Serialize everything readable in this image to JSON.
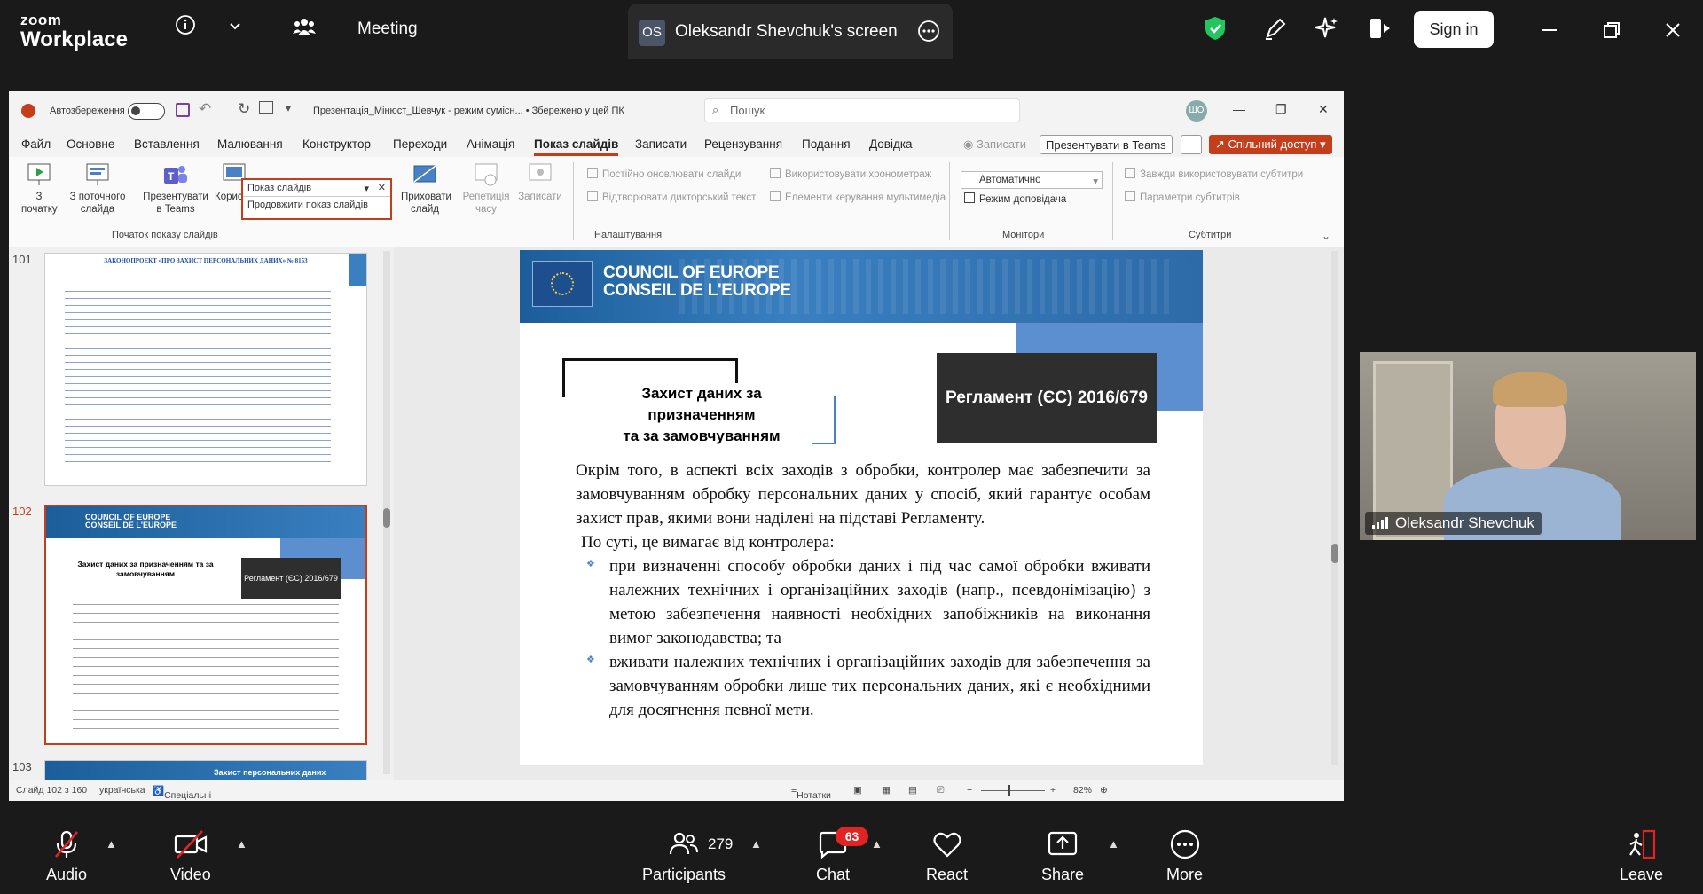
{
  "zoom": {
    "logo_top": "zoom",
    "logo_bottom": "Workplace",
    "meeting_label": "Meeting",
    "screen_badge": "OS",
    "screen_title": "Oleksandr Shevchuk's screen",
    "signin_label": "Sign in",
    "participants_count": "279",
    "chat_badge": "63",
    "bottom": {
      "audio": "Audio",
      "video": "Video",
      "participants": "Participants",
      "chat": "Chat",
      "react": "React",
      "share": "Share",
      "more": "More",
      "leave": "Leave"
    }
  },
  "ppt": {
    "autosave_label": "Автозбереження",
    "filename": "Презентація_Мінюст_Шевчук  -  режим сумісн...  •  Збережено у цей ПК",
    "search_placeholder": "Пошук",
    "avatar_initials": "ШО",
    "menu": [
      "Файл",
      "Основне",
      "Вставлення",
      "Малювання",
      "Конструктор",
      "Переходи",
      "Анімація",
      "Показ слайдів",
      "Записати",
      "Рецензування",
      "Подання",
      "Довідка"
    ],
    "records_label": "Записати",
    "present_teams_label": "Презентувати в Teams",
    "share_label": "Спільний доступ",
    "ribbon": {
      "from_start": "З початку",
      "from_current": "З поточного слайда",
      "present_teams": "Презентувати в Teams",
      "custom_show": "Користувацький показ",
      "hide_slide": "Приховати слайд",
      "rehearse": "Репетиція часу",
      "record": "Записати",
      "group_start": "Початок показу слайдів",
      "group_settings": "Налаштування",
      "group_monitors": "Монітори",
      "group_subtitles": "Субтитри",
      "dropdown_item1": "Показ слайдів",
      "dropdown_item2": "Продовжити показ слайдів",
      "opt_loop": "Постійно оновлювати слайди",
      "opt_narration": "Відтворювати дикторський текст",
      "opt_timings": "Використовувати хронометраж",
      "opt_media": "Елементи керування мультимедіа",
      "monitor_value": "Автоматично",
      "presenter_view": "Режим доповідача",
      "always_subtitles": "Завжди використовувати субтитри",
      "subtitle_params": "Параметри субтитрів"
    },
    "thumbs": {
      "n101": "101",
      "n102": "102",
      "n103": "103",
      "t101_title": "ЗАКОНОПРОЕКТ «ПРО ЗАХИСТ ПЕРСОНАЛЬНИХ ДАНИХ» № 8153",
      "t102_title": "Захист даних за призначенням та за замовчуванням",
      "t102_reg": "Регламент (ЄС) 2016/679",
      "t103_title": "Захист персональних даних"
    },
    "slide": {
      "coe_line1": "COUNCIL OF EUROPE",
      "coe_line2": "CONSEIL DE L'EUROPE",
      "title_line1": "Захист даних за призначенням",
      "title_line2": "та за замовчуванням",
      "regulation": "Регламент (ЄС) 2016/679",
      "para1": "Окрім того, в аспекті всіх заходів з обробки, контролер має забезпечити за замовчуванням обробку персональних даних у спосіб, який гарантує особам захист прав, якими вони наділені на підставі Регламенту.",
      "para2": "По суті, це вимагає від контролера:",
      "bullet1": "при визначенні способу обробки даних і під час самої обробки вживати належних технічних і організаційних заходів (напр., псевдонімізацію) з метою забезпечення наявності необхідних запобіжників на виконання вимог законодавства; та",
      "bullet2": "вживати належних технічних і організаційних заходів для забезпечення за замовчуванням обробки лише тих персональних даних, які є необхідними для досягнення певної мети."
    },
    "status": {
      "slide_counter": "Слайд 102 з 160",
      "language": "українська",
      "accessibility": "Спеціальні можливості: недоступні",
      "notes": "Нотатки",
      "zoom": "82%"
    }
  },
  "video": {
    "participant_name": "Oleksandr Shevchuk"
  }
}
